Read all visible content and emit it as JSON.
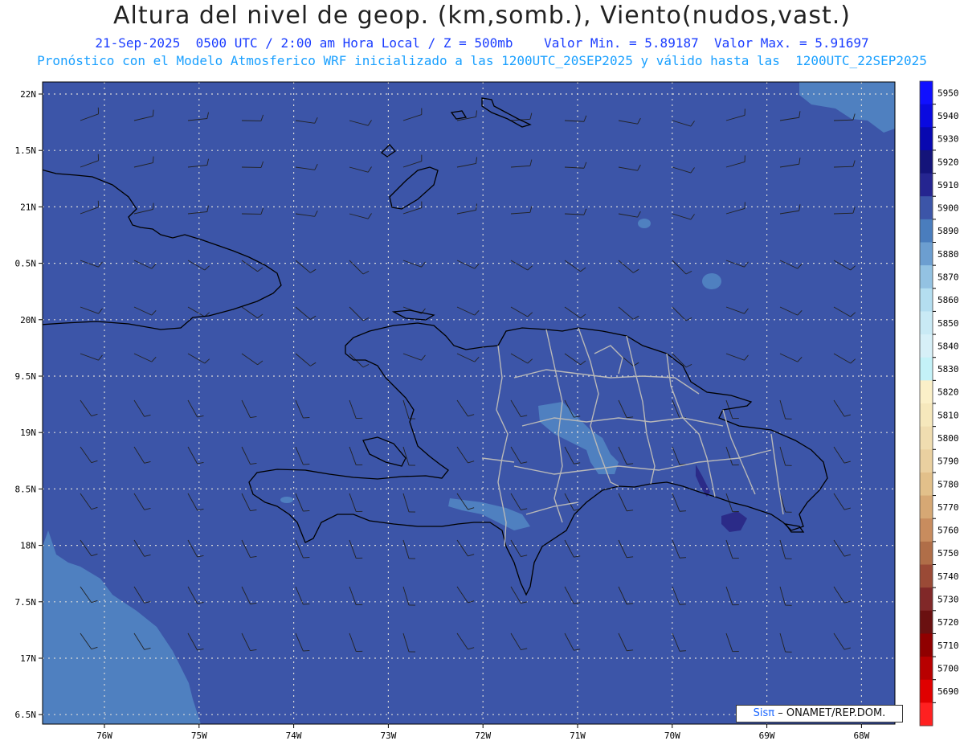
{
  "header": {
    "title": "Altura del nivel de geop. (km,somb.), Viento(nudos,vast.)",
    "subtitle_line1": "21-Sep-2025  0500 UTC / 2:00 am Hora Local / Z = 500mb    Valor Min. = 5.89187  Valor Max. = 5.91697",
    "subtitle_line2": "Pronóstico con el Modelo Atmosferico WRF inicializado a las 1200UTC_20SEP2025 y válido hasta las  1200UTC_22SEP2025"
  },
  "map": {
    "lat_labels": [
      "22N",
      "1.5N",
      "21N",
      "0.5N",
      "20N",
      "9.5N",
      "19N",
      "8.5N",
      "18N",
      "7.5N",
      "17N",
      "6.5N"
    ],
    "lon_labels": [
      "76W",
      "75W",
      "74W",
      "73W",
      "72W",
      "71W",
      "70W",
      "69W",
      "68W"
    ],
    "background_color": "#3c55a8",
    "region_color": "#4f80c0",
    "max_color": "#2b2b88"
  },
  "colorbar": {
    "levels": [
      "5950",
      "5940",
      "5930",
      "5920",
      "5910",
      "5900",
      "5890",
      "5880",
      "5870",
      "5860",
      "5850",
      "5840",
      "5830",
      "5820",
      "5810",
      "5800",
      "5790",
      "5780",
      "5770",
      "5760",
      "5750",
      "5740",
      "5730",
      "5720",
      "5710",
      "5700",
      "5690"
    ],
    "colors": [
      "#1010ff",
      "#0a0ae0",
      "#0808b0",
      "#14147a",
      "#252590",
      "#3c55a8",
      "#4a7dbd",
      "#6c9ed0",
      "#93c2e2",
      "#b4def0",
      "#c9eaf5",
      "#d7f0f8",
      "#c4f2f8",
      "#fbf0c8",
      "#f6e8bc",
      "#f0ddb0",
      "#ead0a0",
      "#e2c08a",
      "#d6a874",
      "#c88c5e",
      "#b06e48",
      "#9a4a36",
      "#802828",
      "#6a1010",
      "#900000",
      "#b80000",
      "#e00000",
      "#ff2020"
    ]
  },
  "credit": {
    "brand": "Sisπ",
    "org": "– ONAMET/REP.DOM."
  }
}
